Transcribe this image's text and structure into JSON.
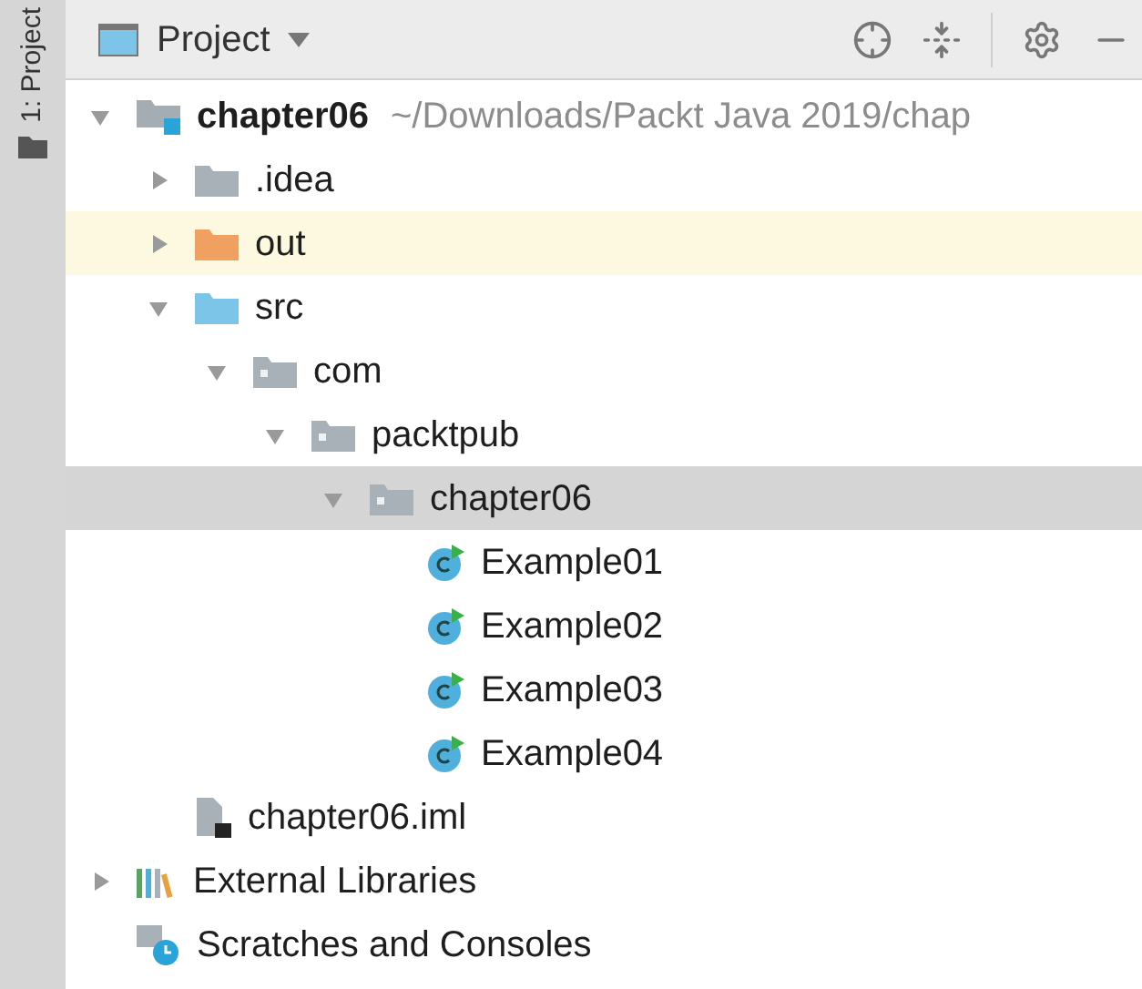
{
  "side_tab": {
    "label": "1: Project"
  },
  "header": {
    "title": "Project"
  },
  "tree": [
    {
      "label": "chapter06",
      "path": "~/Downloads/Packt Java 2019/chap",
      "kind": "project",
      "expanded": true,
      "selected": false,
      "highlighted": false,
      "children": [
        {
          "label": ".idea",
          "kind": "folder",
          "expanded": false,
          "selected": false,
          "highlighted": false
        },
        {
          "label": "out",
          "kind": "excluded_folder",
          "expanded": false,
          "selected": false,
          "highlighted": true
        },
        {
          "label": "src",
          "kind": "source_folder",
          "expanded": true,
          "selected": false,
          "highlighted": false,
          "children": [
            {
              "label": "com",
              "kind": "package",
              "expanded": true,
              "selected": false,
              "highlighted": false,
              "children": [
                {
                  "label": "packtpub",
                  "kind": "package",
                  "expanded": true,
                  "selected": false,
                  "highlighted": false,
                  "children": [
                    {
                      "label": "chapter06",
                      "kind": "package",
                      "expanded": true,
                      "selected": true,
                      "highlighted": false,
                      "children": [
                        {
                          "label": "Example01",
                          "kind": "class",
                          "selected": false,
                          "highlighted": false
                        },
                        {
                          "label": "Example02",
                          "kind": "class",
                          "selected": false,
                          "highlighted": false
                        },
                        {
                          "label": "Example03",
                          "kind": "class",
                          "selected": false,
                          "highlighted": false
                        },
                        {
                          "label": "Example04",
                          "kind": "class",
                          "selected": false,
                          "highlighted": false
                        }
                      ]
                    }
                  ]
                }
              ]
            }
          ]
        },
        {
          "label": "chapter06.iml",
          "kind": "module_file",
          "selected": false,
          "highlighted": false
        }
      ]
    },
    {
      "label": "External Libraries",
      "kind": "libraries",
      "expanded": false,
      "selected": false,
      "highlighted": false
    },
    {
      "label": "Scratches and Consoles",
      "kind": "scratches",
      "selected": false,
      "highlighted": false
    }
  ]
}
